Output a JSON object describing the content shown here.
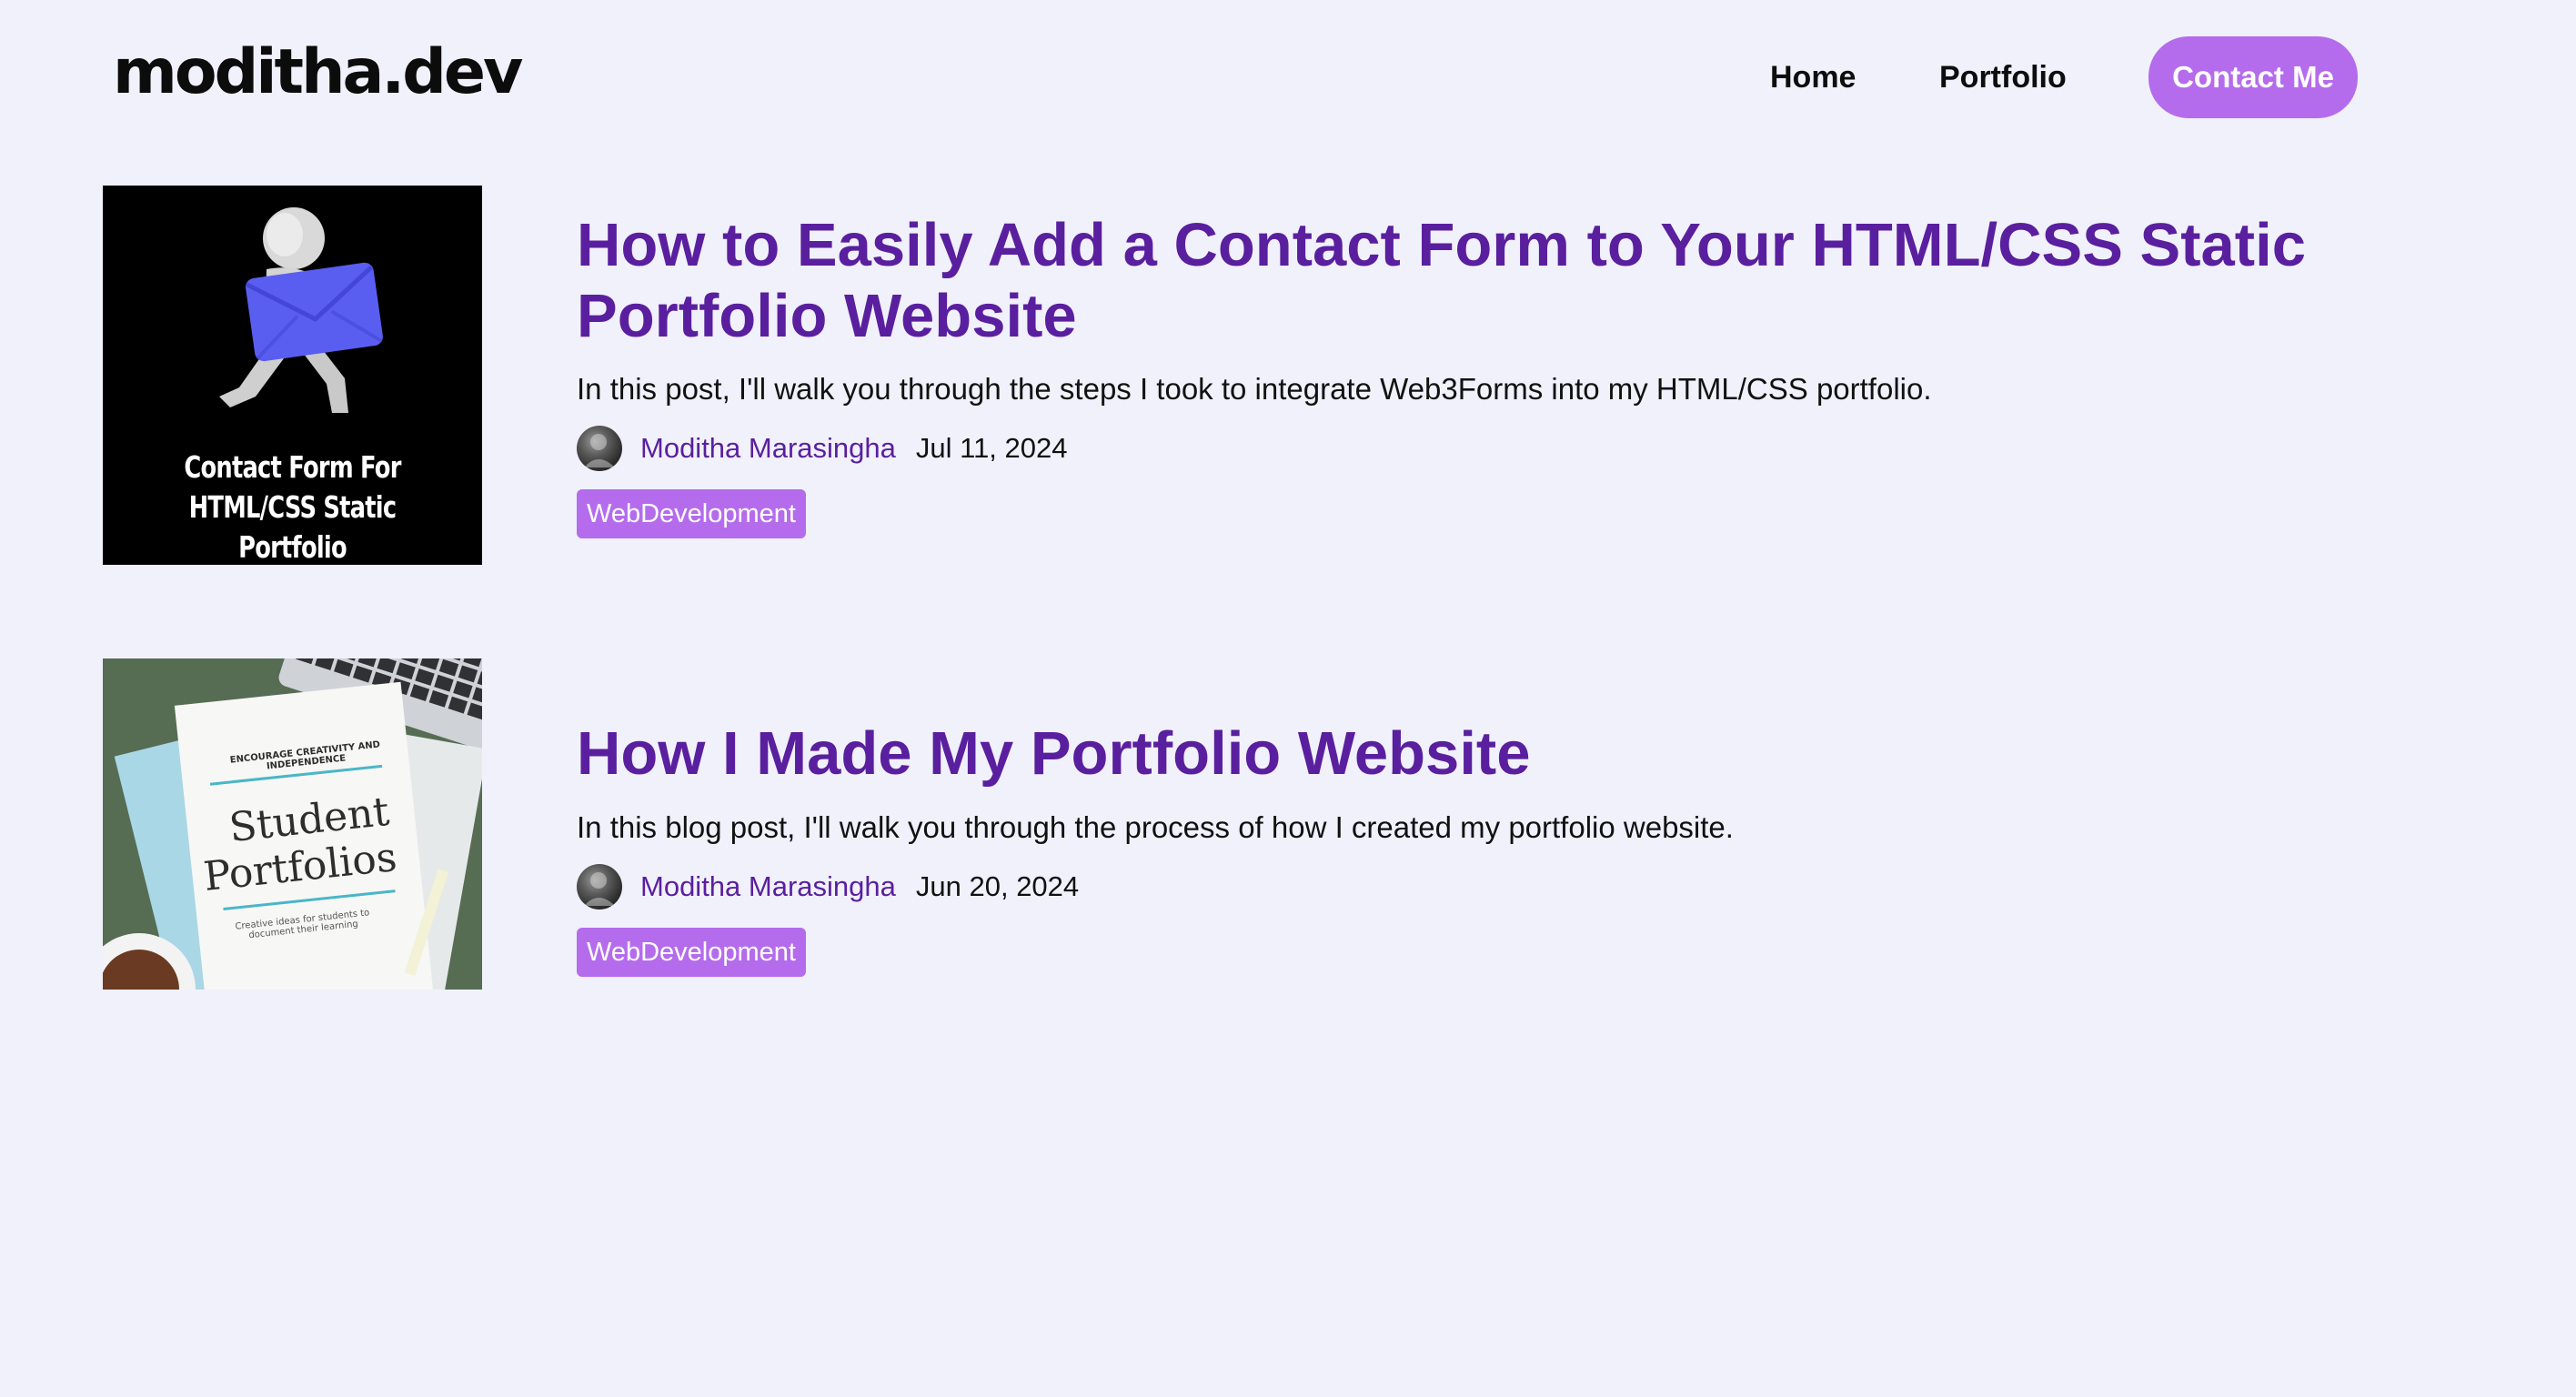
{
  "header": {
    "logo": "moditha.dev",
    "nav": {
      "home": "Home",
      "portfolio": "Portfolio",
      "contact": "Contact Me"
    }
  },
  "colors": {
    "background": "#f0f1fb",
    "title_purple": "#5a1f9e",
    "accent_purple": "#b56cec"
  },
  "posts": [
    {
      "title": "How to Easily Add a Contact Form to Your HTML/CSS Static Portfolio Website",
      "description": "In this post, I'll walk you through the steps I took to integrate Web3Forms into my HTML/CSS portfolio.",
      "author": "Moditha Marasingha",
      "date": "Jul 11, 2024",
      "tag": "WebDevelopment",
      "thumbnail": {
        "line1": "Contact Form For",
        "line2": "HTML/CSS Static Portfolio"
      }
    },
    {
      "title": "How I Made My Portfolio Website",
      "description": "In this blog post, I'll walk you through the process of how I created my portfolio website.",
      "author": "Moditha Marasingha",
      "date": "Jun 20, 2024",
      "tag": "WebDevelopment",
      "thumbnail": {
        "small_top": "ENCOURAGE CREATIVITY AND INDEPENDENCE",
        "line1": "Student",
        "line2": "Portfolios",
        "small_bottom": "Creative ideas for students to document their learning"
      }
    }
  ]
}
